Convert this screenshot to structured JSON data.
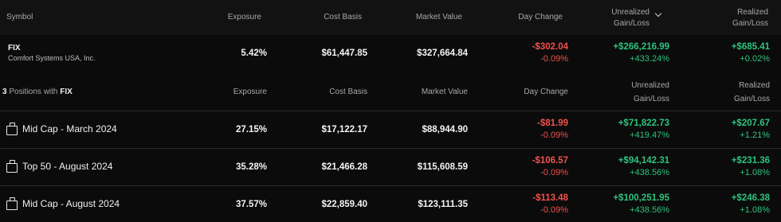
{
  "header": {
    "symbol": "Symbol",
    "exposure": "Exposure",
    "cost_basis": "Cost Basis",
    "market_value": "Market Value",
    "day_change": "Day Change",
    "unrealized_1": "Unrealized",
    "unrealized_2": "Gain/Loss",
    "realized_1": "Realized",
    "realized_2": "Gain/Loss",
    "sort_icon": "chevron-down-icon"
  },
  "summary": {
    "symbol": "FIX",
    "company": "Comfort Systems USA, Inc.",
    "exposure": "5.42%",
    "cost_basis": "$61,447.85",
    "market_value": "$327,664.84",
    "day_change": "-$302.04",
    "day_change_pct": "-0.09%",
    "unrealized": "+$266,216.99",
    "unrealized_pct": "+433.24%",
    "realized": "+$685.41",
    "realized_pct": "+0.02%"
  },
  "subheader": {
    "count": "3",
    "text": "Positions with",
    "symbol": "FIX",
    "exposure": "Exposure",
    "cost_basis": "Cost Basis",
    "market_value": "Market Value",
    "day_change": "Day Change",
    "unrealized_1": "Unrealized",
    "unrealized_2": "Gain/Loss",
    "realized_1": "Realized",
    "realized_2": "Gain/Loss"
  },
  "positions": [
    {
      "icon": "briefcase-icon",
      "name": "Mid Cap - March 2024",
      "exposure": "27.15%",
      "cost_basis": "$17,122.17",
      "market_value": "$88,944.90",
      "day_change": "-$81.99",
      "day_change_pct": "-0.09%",
      "unrealized": "+$71,822.73",
      "unrealized_pct": "+419.47%",
      "realized": "+$207.67",
      "realized_pct": "+1.21%"
    },
    {
      "icon": "briefcase-icon",
      "name": "Top 50 - August 2024",
      "exposure": "35.28%",
      "cost_basis": "$21,466.28",
      "market_value": "$115,608.59",
      "day_change": "-$106.57",
      "day_change_pct": "-0.09%",
      "unrealized": "+$94,142.31",
      "unrealized_pct": "+438.56%",
      "realized": "+$231.36",
      "realized_pct": "+1.08%"
    },
    {
      "icon": "briefcase-icon",
      "name": "Mid Cap - August 2024",
      "exposure": "37.57%",
      "cost_basis": "$22,859.40",
      "market_value": "$123,111.35",
      "day_change": "-$113.48",
      "day_change_pct": "-0.09%",
      "unrealized": "+$100,251.95",
      "unrealized_pct": "+438.56%",
      "realized": "+$246.38",
      "realized_pct": "+1.08%"
    }
  ],
  "colors": {
    "negative": "#f0514e",
    "positive": "#2ec27e",
    "background": "#0b0b0b"
  }
}
